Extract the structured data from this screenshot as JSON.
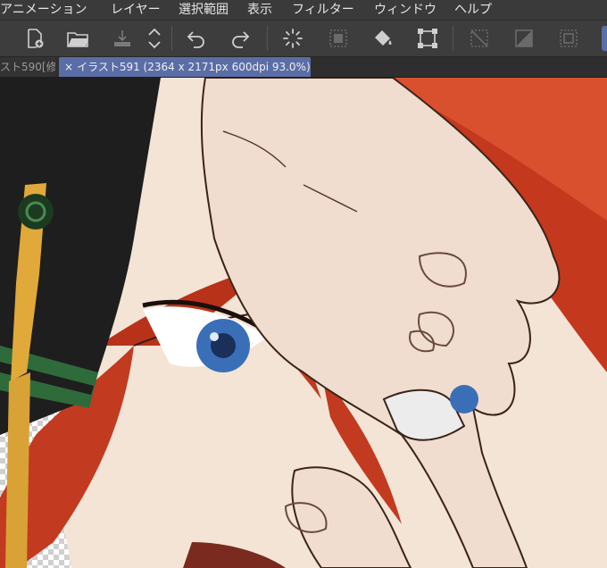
{
  "menu": {
    "items": [
      "アニメーション",
      "レイヤー",
      "選択範囲",
      "表示",
      "フィルター",
      "ウィンドウ",
      "ヘルプ"
    ]
  },
  "toolbar": {
    "icons": [
      "new-canvas-icon",
      "open-folder-icon",
      "save-icon",
      "scroll-arrows-icon",
      "undo-icon",
      "redo-icon",
      "loading-icon",
      "select-area-icon",
      "fill-bucket-icon",
      "transform-icon",
      "clear-selection-icon",
      "invert-selection-icon",
      "selection-border-icon"
    ]
  },
  "tabs": {
    "inactive_label": "スト590[修",
    "active_close": "×",
    "active_label": "イラスト591 (2364 x 2171px 600dpi 93.0%)"
  },
  "colors": {
    "accent": "#5b6da6",
    "hair": "#c8351c",
    "skin": "#f5e6d8",
    "hat": "#1e1e1e",
    "tassel": "#e0a93a",
    "eye": "#3a6fb8"
  }
}
